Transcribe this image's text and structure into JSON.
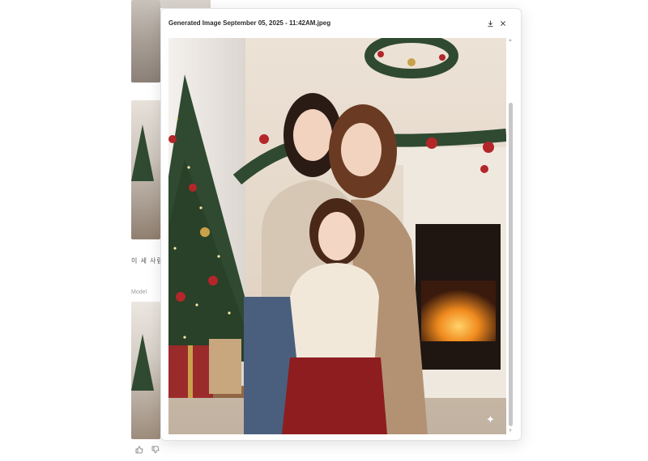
{
  "modal": {
    "title": "Generated Image September 05, 2025 - 11:42AM.jpeg",
    "download_icon": "download-icon",
    "close_icon": "close-icon",
    "image_alt": "Two women and a girl embracing in front of a Christmas tree and a lit fireplace",
    "watermark_icon": "sparkle-icon"
  },
  "background": {
    "partial_text": "이 세 사람이",
    "model_label": "Model",
    "actions": [
      "thumbs-up-icon",
      "thumbs-down-icon"
    ]
  },
  "colors": {
    "modal_bg": "#ffffff",
    "title_text": "#2b2b2b",
    "scrollbar": "#c7c7c7",
    "wall": "#e8dccd",
    "tree": "#2f4a30",
    "ornament": "#b3262a",
    "fire": "#f08a1e",
    "skirt": "#8e1d1f"
  }
}
